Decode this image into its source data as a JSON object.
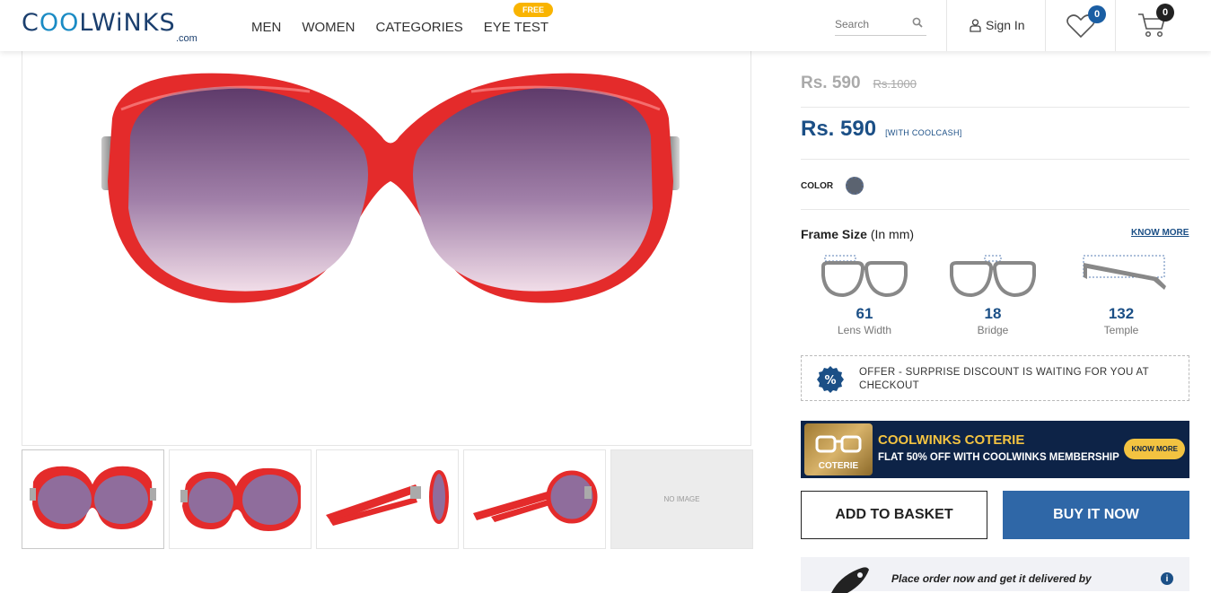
{
  "header": {
    "logo_text_a": "C",
    "logo_text_oo": "OO",
    "logo_text_b": "LWiNKS",
    "logo_sub": ".com",
    "nav": [
      "MEN",
      "WOMEN",
      "CATEGORIES",
      "EYE TEST"
    ],
    "free_badge": "FREE",
    "search_placeholder": "Search",
    "sign_in": "Sign In",
    "wishlist_count": "0",
    "cart_count": "0"
  },
  "gallery": {
    "no_image_text": "NO IMAGE"
  },
  "product": {
    "price_old": "Rs. 590",
    "price_mrp": "Rs.1000",
    "price": "Rs. 590",
    "coolcash_label": "[WITH COOLCASH]",
    "color_label": "COLOR",
    "swatch_color": "#5b6370",
    "frame_size_title": "Frame Size",
    "frame_size_unit": "(In mm)",
    "know_more": "KNOW MORE",
    "sizes": [
      {
        "value": "61",
        "label": "Lens Width"
      },
      {
        "value": "18",
        "label": "Bridge"
      },
      {
        "value": "132",
        "label": "Temple"
      }
    ]
  },
  "offer": {
    "icon": "%",
    "text": "OFFER - SURPRISE DISCOUNT IS WAITING FOR YOU AT CHECKOUT"
  },
  "coterie": {
    "badge_text": "COTERIE",
    "title": "COOLWINKS COTERIE",
    "subtitle": "FLAT 50% OFF WITH  COOLWINKS MEMBERSHIP",
    "button": "KNOW MORE"
  },
  "actions": {
    "add_to_basket": "ADD TO BASKET",
    "buy_now": "BUY IT NOW"
  },
  "delivery": {
    "text": "Place order now and get it delivered by",
    "info_icon": "i"
  },
  "colors": {
    "brand_blue": "#1b4f86",
    "buy_button": "#2f67a7",
    "frame_red": "#e42b2b",
    "coterie_bg": "#0d2347",
    "coterie_gold": "#f3c341"
  }
}
